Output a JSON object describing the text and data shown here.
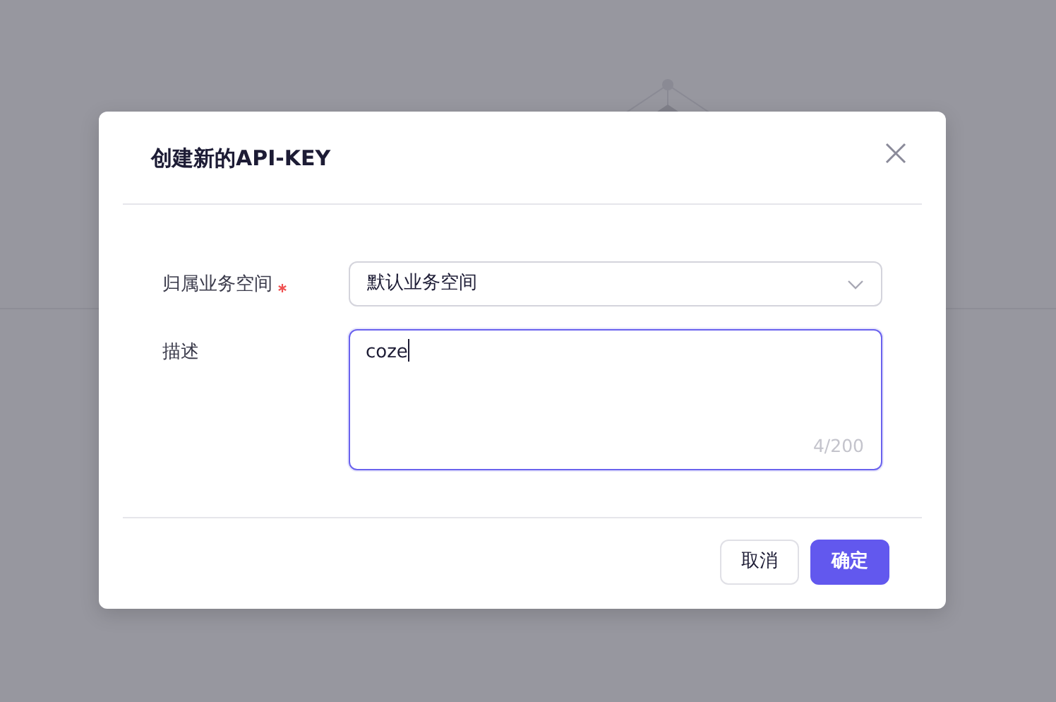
{
  "dialog": {
    "title": "创建新的API-KEY",
    "fields": [
      {
        "kind": "select",
        "label": "归属业务空间",
        "required": true,
        "value": "默认业务空间",
        "focused": false
      },
      {
        "kind": "textarea",
        "label": "描述",
        "required": false,
        "value": "coze",
        "counter": "4/200",
        "focused": true
      }
    ],
    "buttons": [
      {
        "label": "取消",
        "primary": false
      },
      {
        "label": "确定",
        "primary": true
      }
    ]
  }
}
